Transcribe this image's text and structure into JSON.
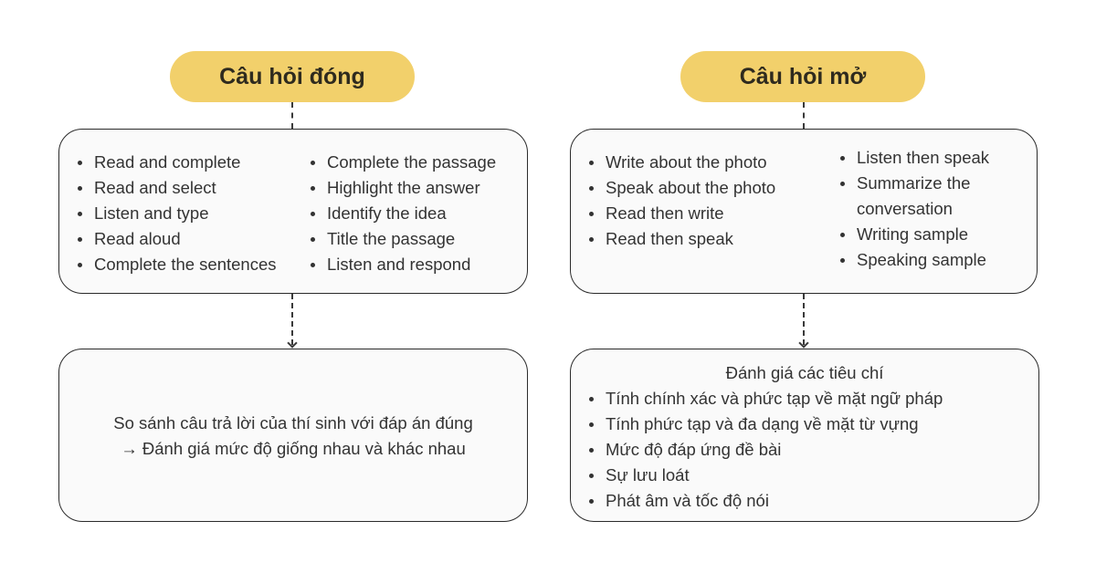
{
  "closed": {
    "title": "Câu hỏi đóng",
    "types_col1": [
      "Read and complete",
      "Read and select",
      "Listen and type",
      "Read aloud",
      "Complete the sentences"
    ],
    "types_col2": [
      "Complete the passage",
      "Highlight the answer",
      "Identify the idea",
      "Title the passage",
      "Listen and respond"
    ],
    "evaluation_line1": "So sánh câu trả lời của thí sinh với đáp án đúng",
    "evaluation_line2": "→ Đánh giá mức độ giống nhau và khác nhau"
  },
  "open": {
    "title": "Câu hỏi mở",
    "types_col1": [
      "Write about the photo",
      "Speak about the photo",
      "Read then write",
      "Read then speak"
    ],
    "types_col2": [
      "Listen then speak",
      "Summarize the conversation",
      "Writing sample",
      "Speaking sample"
    ],
    "evaluation_heading": "Đánh giá các tiêu chí",
    "criteria": [
      "Tính chính xác và phức tạp về mặt ngữ pháp",
      "Tính phức tạp và đa dạng về mặt từ vựng",
      "Mức độ đáp ứng đề bài",
      "Sự lưu loát",
      "Phát âm và tốc độ nói"
    ]
  },
  "colors": {
    "pill": "#f2d06b",
    "box_bg": "#fafafa",
    "border": "#2b2b2b"
  }
}
